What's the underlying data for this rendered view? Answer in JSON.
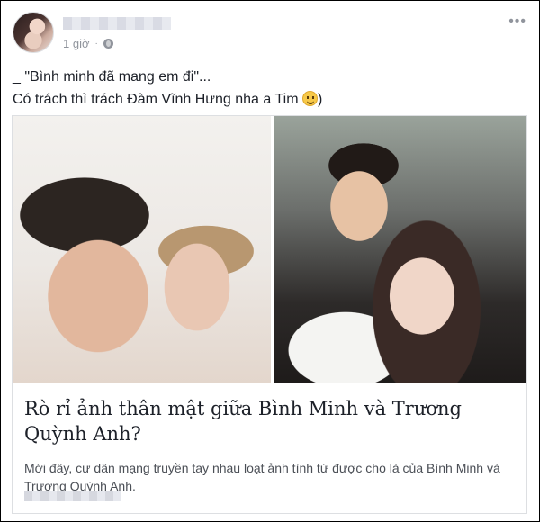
{
  "post": {
    "time": "1 giờ",
    "separator": "·",
    "more_icon": "ellipsis-icon",
    "text_line1": "_ \"Bình minh đã mang em đi\"...",
    "text_line2_before": "Có trách thì trách Đàm Vĩnh Hưng nha a Tim ",
    "text_line2_after": ")"
  },
  "link_card": {
    "title": "Rò rỉ ảnh thân mật giữa Bình Minh và Trương Quỳnh Anh?",
    "description": "Mới đây, cư dân mạng truyền tay nhau loạt ảnh tình tứ được cho là của Bình Minh và Trương Quỳnh Anh."
  }
}
